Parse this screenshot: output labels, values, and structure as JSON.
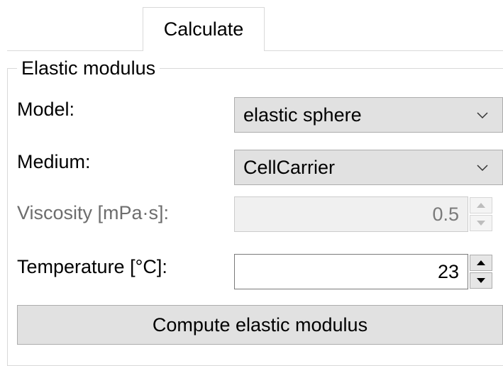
{
  "tabs": [
    {
      "label": "Calculate"
    }
  ],
  "group": {
    "title": "Elastic modulus"
  },
  "form": {
    "model": {
      "label": "Model:",
      "value": "elastic sphere",
      "icon": "chevron-down-icon"
    },
    "medium": {
      "label": "Medium:",
      "value": "CellCarrier",
      "icon": "chevron-down-icon"
    },
    "viscosity": {
      "label": "Viscosity [mPa·s]:",
      "value": "0.5",
      "enabled": false
    },
    "temperature": {
      "label": "Temperature [°C]:",
      "value": "23",
      "enabled": true
    }
  },
  "actions": {
    "compute_label": "Compute elastic modulus"
  },
  "colors": {
    "button_bg": "#e1e1e1",
    "border": "#adadad",
    "disabled_bg": "#f0f0f0"
  }
}
